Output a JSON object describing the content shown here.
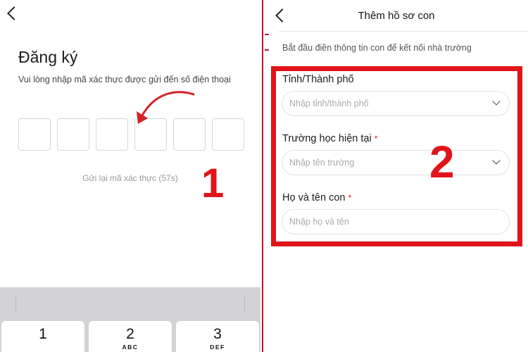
{
  "left": {
    "title": "Đăng ký",
    "subtitle": "Vui lòng nhập mã xác thực được gửi đến số điện thoại",
    "otp_count": 6,
    "resend": "Gửi lại mã xác thực (57s)",
    "annotation_number": "1",
    "keyboard": {
      "keys": [
        {
          "digit": "1",
          "letters": ""
        },
        {
          "digit": "2",
          "letters": "ABC"
        },
        {
          "digit": "3",
          "letters": "DEF"
        }
      ]
    }
  },
  "right": {
    "title": "Thêm hồ sơ con",
    "subtitle": "Bắt đầu điền thông tin con để kết nối nhà trường",
    "fields": [
      {
        "label": "Tỉnh/Thành phố",
        "required": false,
        "placeholder": "Nhập tỉnh/thành phố",
        "dropdown": true
      },
      {
        "label": "Trường học hiện tại",
        "required": true,
        "placeholder": "Nhập tên trường",
        "dropdown": true
      },
      {
        "label": "Họ và tên con",
        "required": true,
        "placeholder": "Nhập họ và tên",
        "dropdown": false
      }
    ],
    "required_mark": "*",
    "annotation_number": "2"
  },
  "colors": {
    "annotation_red": "#e1141b",
    "divider_red": "#c8102e",
    "keyboard_bg": "#d3d3d6"
  }
}
